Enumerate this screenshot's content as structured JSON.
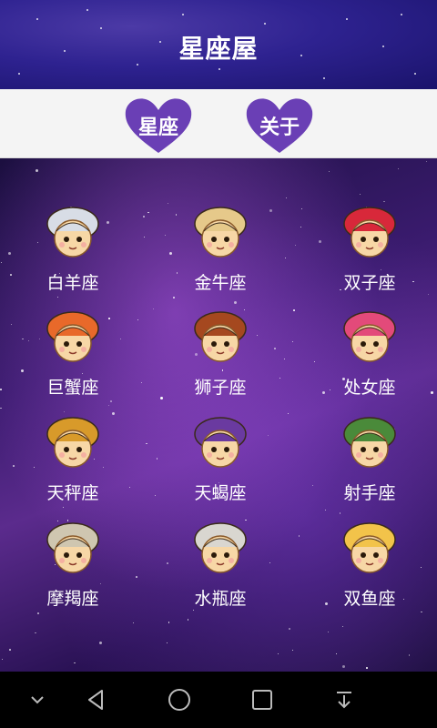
{
  "header": {
    "title": "星座屋"
  },
  "toolbar": {
    "buttons": [
      {
        "label": "星座",
        "icon": "heart-icon"
      },
      {
        "label": "关于",
        "icon": "heart-icon"
      }
    ]
  },
  "zodiac": [
    {
      "name": "白羊座",
      "accent": "#d8dde6",
      "icon": "aries-icon"
    },
    {
      "name": "金牛座",
      "accent": "#e6c98a",
      "icon": "taurus-icon"
    },
    {
      "name": "双子座",
      "accent": "#d8283a",
      "icon": "gemini-icon"
    },
    {
      "name": "巨蟹座",
      "accent": "#e8692a",
      "icon": "cancer-icon"
    },
    {
      "name": "狮子座",
      "accent": "#a5481f",
      "icon": "leo-icon"
    },
    {
      "name": "处女座",
      "accent": "#e34a7a",
      "icon": "virgo-icon"
    },
    {
      "name": "天秤座",
      "accent": "#d89a2a",
      "icon": "libra-icon"
    },
    {
      "name": "天蝎座",
      "accent": "#6a3aa0",
      "icon": "scorpio-icon"
    },
    {
      "name": "射手座",
      "accent": "#4a8a3a",
      "icon": "sagittarius-icon"
    },
    {
      "name": "摩羯座",
      "accent": "#cfc6b0",
      "icon": "capricorn-icon"
    },
    {
      "name": "水瓶座",
      "accent": "#d9d6d0",
      "icon": "aquarius-icon"
    },
    {
      "name": "双鱼座",
      "accent": "#f2c34a",
      "icon": "pisces-icon"
    }
  ],
  "colors": {
    "heart": "#6a3fb5",
    "skin": "#f7d7a6",
    "accent_purple": "#2e2290"
  },
  "navbar": {
    "buttons": [
      "chevron-down-icon",
      "back-icon",
      "home-icon",
      "recents-icon",
      "download-icon"
    ]
  }
}
